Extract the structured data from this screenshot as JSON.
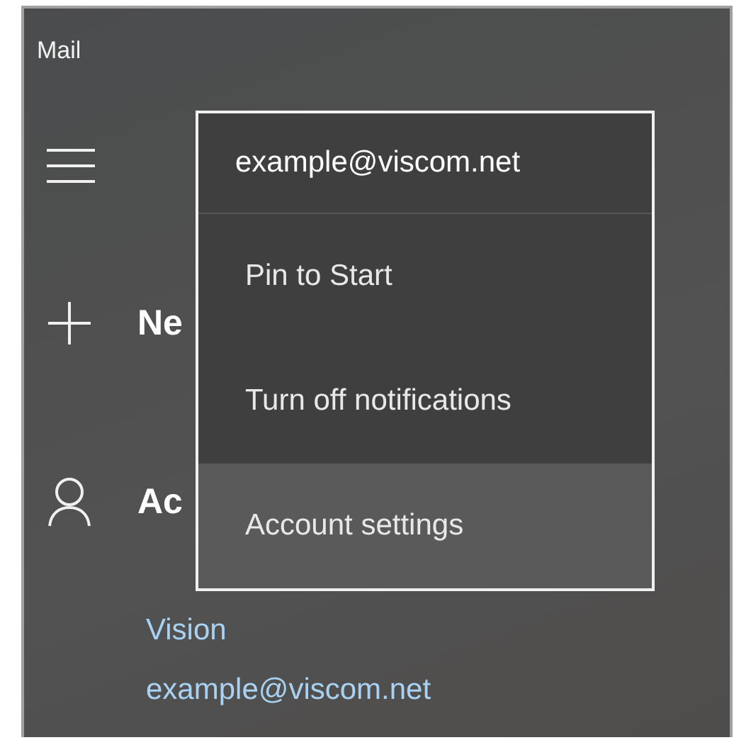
{
  "window": {
    "title": "Mail"
  },
  "nav": [
    {
      "kind": "new",
      "label": "Ne"
    },
    {
      "kind": "account",
      "label": "Ac"
    }
  ],
  "account": {
    "name": "Vision",
    "email": "example@viscom.net"
  },
  "context_menu": {
    "header": "example@viscom.net",
    "items": [
      {
        "label": "Pin to Start",
        "selected": false
      },
      {
        "label": "Turn off notifications",
        "selected": false
      },
      {
        "label": "Account settings",
        "selected": true
      }
    ]
  }
}
